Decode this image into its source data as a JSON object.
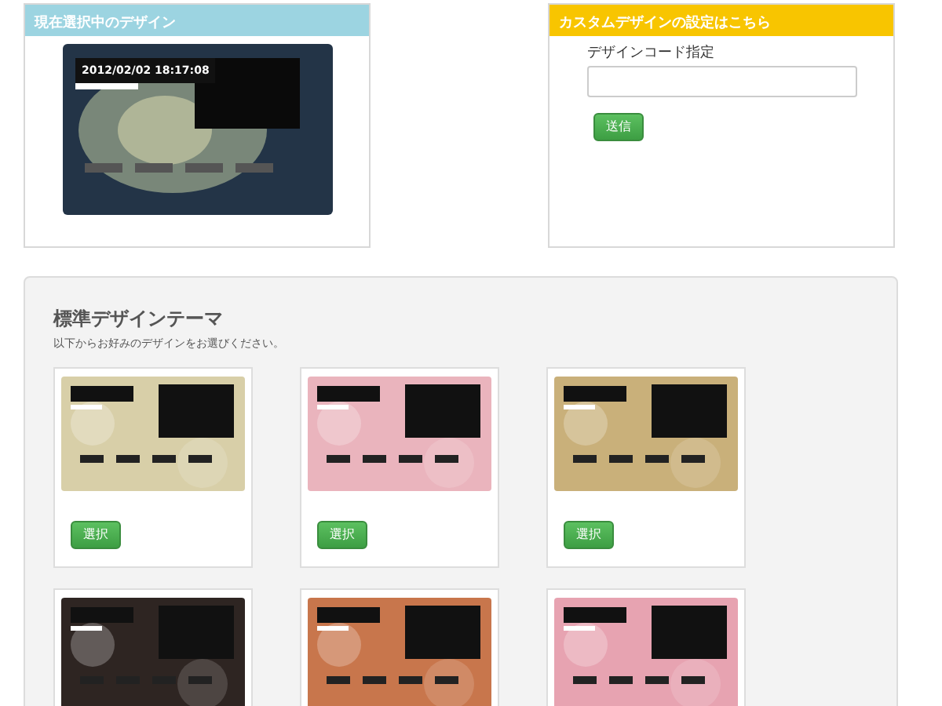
{
  "current_panel": {
    "title": "現在選択中のデザイン",
    "preview": {
      "clock": "2012/02/02 18:17:08"
    }
  },
  "custom_panel": {
    "title": "カスタムデザインの設定はこちら",
    "field_label": "デザインコード指定",
    "submit_button": "送信"
  },
  "standard_themes": {
    "title": "標準デザインテーマ",
    "subtitle": "以下からお好みのデザインをお選びください。",
    "themes": [
      {
        "color": "#d8cfa8",
        "select_button": "選択"
      },
      {
        "color": "#eab4bd",
        "select_button": "選択"
      },
      {
        "color": "#c9b07a",
        "select_button": "選択"
      },
      {
        "color": "#2e2522"
      },
      {
        "color": "#c8764c"
      },
      {
        "color": "#e7a3b1"
      }
    ]
  }
}
